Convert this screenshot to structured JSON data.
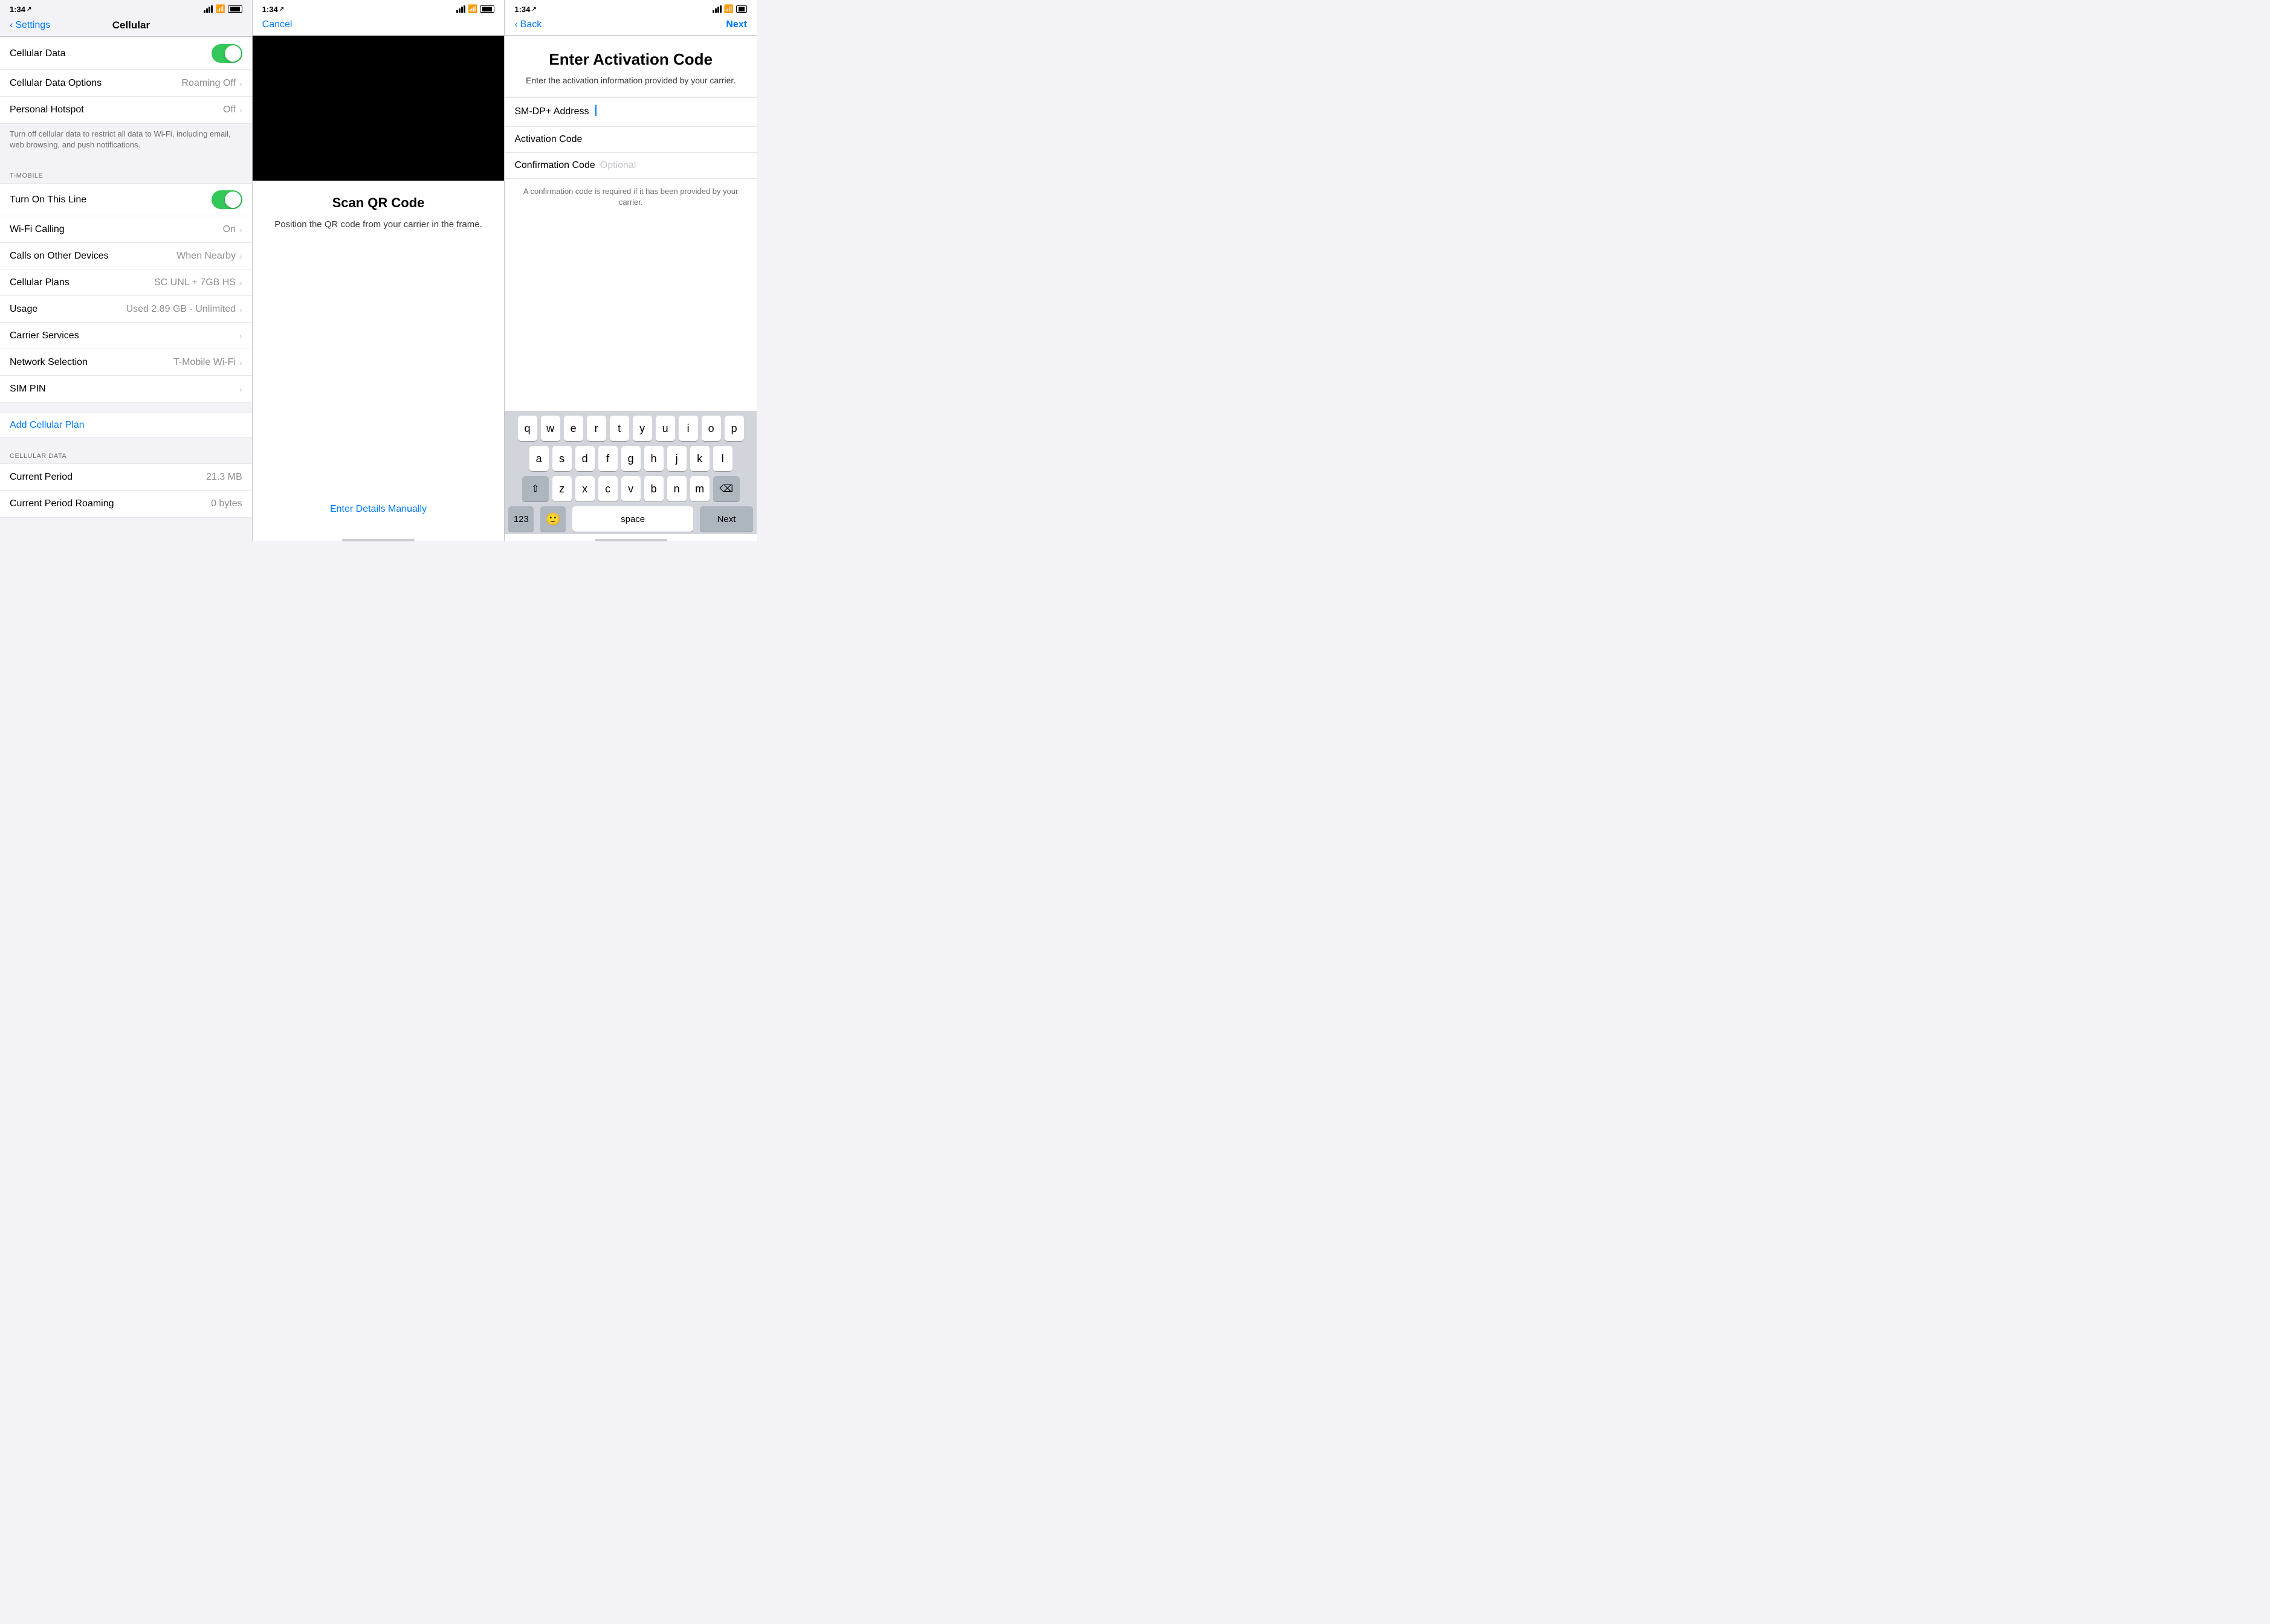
{
  "panels": {
    "panel1": {
      "status": {
        "time": "1:34",
        "location_icon": "↗"
      },
      "nav": {
        "back_label": "Settings",
        "title": "Cellular"
      },
      "rows": [
        {
          "label": "Cellular Data",
          "value": "",
          "toggle": true,
          "toggled": true
        },
        {
          "label": "Cellular Data Options",
          "value": "Roaming Off",
          "toggle": false,
          "chevron": true
        },
        {
          "label": "Personal Hotspot",
          "value": "Off",
          "toggle": false,
          "chevron": true
        }
      ],
      "note": "Turn off cellular data to restrict all data to Wi-Fi, including email, web browsing, and push notifications.",
      "t_mobile_header": "T-MOBILE",
      "t_mobile_rows": [
        {
          "label": "Turn On This Line",
          "value": "",
          "toggle": true,
          "toggled": true
        },
        {
          "label": "Wi-Fi Calling",
          "value": "On",
          "chevron": true
        },
        {
          "label": "Calls on Other Devices",
          "value": "When Nearby",
          "chevron": true
        },
        {
          "label": "Cellular Plans",
          "value": "SC UNL + 7GB HS",
          "chevron": true
        },
        {
          "label": "Usage",
          "value": "Used 2.89 GB - Unlimited",
          "chevron": true
        },
        {
          "label": "Carrier Services",
          "value": "",
          "chevron": true
        },
        {
          "label": "Network Selection",
          "value": "T-Mobile Wi-Fi",
          "chevron": true
        },
        {
          "label": "SIM PIN",
          "value": "",
          "chevron": true
        }
      ],
      "add_plan": "Add Cellular Plan",
      "cellular_data_header": "CELLULAR DATA",
      "cellular_data_rows": [
        {
          "label": "Current Period",
          "value": "21.3 MB"
        },
        {
          "label": "Current Period Roaming",
          "value": "0 bytes"
        }
      ]
    },
    "panel2": {
      "status": {
        "time": "1:34",
        "location_icon": "↗"
      },
      "nav": {
        "cancel_label": "Cancel"
      },
      "qr_title": "Scan QR Code",
      "qr_subtitle": "Position the QR code from your carrier in the frame.",
      "enter_manually": "Enter Details Manually"
    },
    "panel3": {
      "status": {
        "time": "1:34",
        "location_icon": "↗"
      },
      "nav": {
        "back_label": "Back",
        "next_label": "Next"
      },
      "title": "Enter Activation Code",
      "subtitle": "Enter the activation information provided by your carrier.",
      "fields": [
        {
          "id": "smdp",
          "label": "SM-DP+ Address",
          "placeholder": "",
          "has_cursor": true
        },
        {
          "id": "activation",
          "label": "Activation Code",
          "placeholder": ""
        },
        {
          "id": "confirmation",
          "label": "Confirmation Code",
          "placeholder": "Optional"
        }
      ],
      "note": "A confirmation code is required if it has been provided by your carrier.",
      "keyboard": {
        "row1": [
          "q",
          "w",
          "e",
          "r",
          "t",
          "y",
          "u",
          "i",
          "o",
          "p"
        ],
        "row2": [
          "a",
          "s",
          "d",
          "f",
          "g",
          "h",
          "j",
          "k",
          "l"
        ],
        "row3": [
          "z",
          "x",
          "c",
          "v",
          "b",
          "n",
          "m"
        ],
        "numbers_label": "123",
        "space_label": "space",
        "next_label": "Next"
      }
    }
  }
}
